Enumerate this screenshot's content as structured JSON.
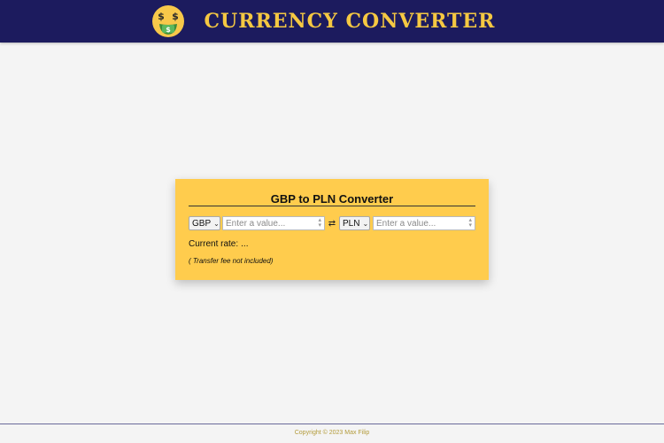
{
  "header": {
    "title": "CURRENCY CONVERTER",
    "logo_icon": "money-mouth-face-icon",
    "background": "#1c1b5e",
    "title_color": "#f5c842"
  },
  "converter": {
    "title": "GBP to PLN Converter",
    "background": "#ffcc4d",
    "from_currency": "GBP",
    "from_placeholder": "Enter a value...",
    "swap_symbol": "⇄",
    "to_currency": "PLN",
    "to_placeholder": "Enter a value...",
    "rate_label": "Current rate:",
    "rate_value": "...",
    "fee_note": "( Transfer fee not included)"
  },
  "footer": {
    "copyright": "Copyright © 2023 Max Filip"
  }
}
